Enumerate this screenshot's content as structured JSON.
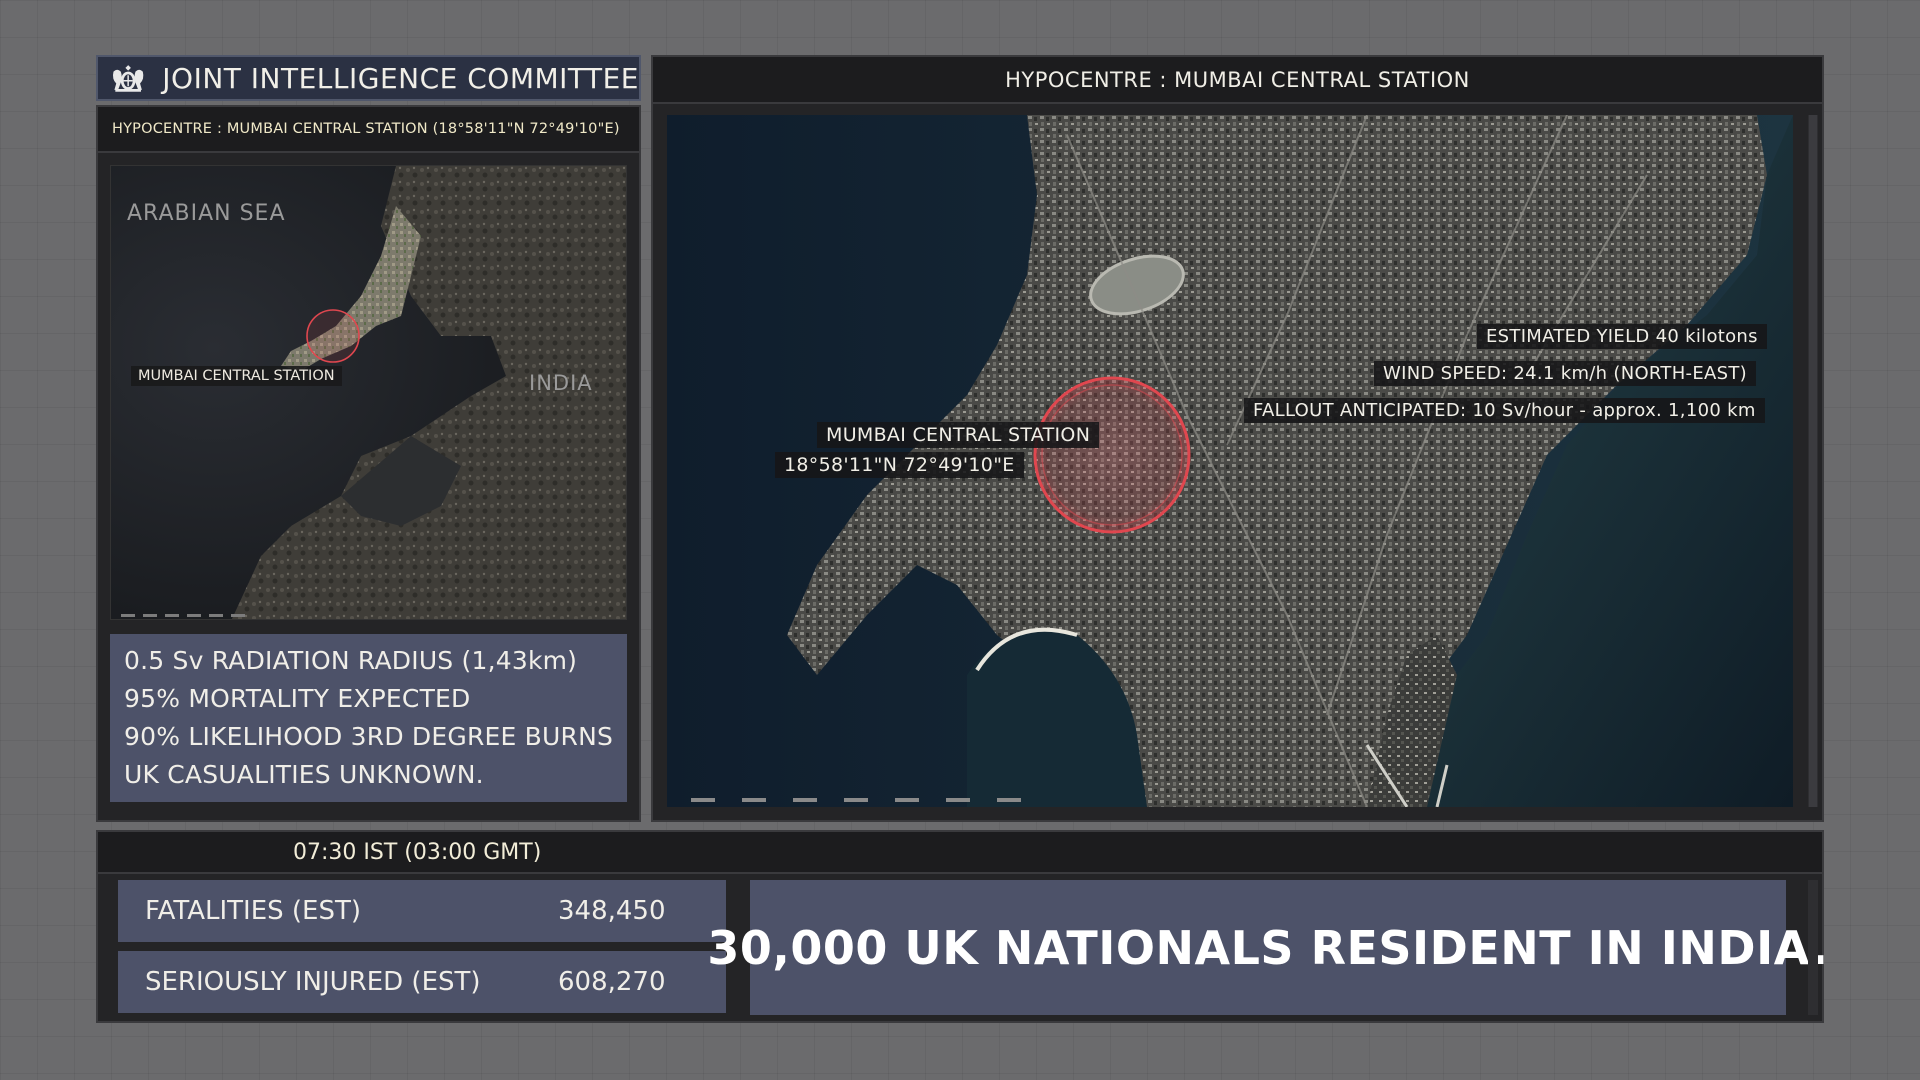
{
  "header": {
    "title": "JOINT INTELLIGENCE COMMITTEE",
    "crest_icon": "royal-crest-icon"
  },
  "left": {
    "caption": "HYPOCENTRE : MUMBAI CENTRAL STATION (18°58'11\"N 72°49'10\"E)",
    "map_labels": {
      "sea": "ARABIAN SEA",
      "country": "INDIA",
      "station": "MUMBAI CENTRAL STATION"
    },
    "stats": [
      "0.5 Sv RADIATION RADIUS (1,43km)",
      "95% MORTALITY EXPECTED",
      "90% LIKELIHOOD 3RD DEGREE BURNS",
      "UK CASUALITIES UNKNOWN."
    ]
  },
  "right": {
    "caption": "HYPOCENTRE : MUMBAI CENTRAL STATION",
    "station_label": "MUMBAI CENTRAL STATION",
    "coords": "18°58'11\"N 72°49'10\"E",
    "yield": "ESTIMATED YIELD 40 kilotons",
    "wind": "WIND SPEED: 24.1 km/h (NORTH-EAST)",
    "fallout": "FALLOUT ANTICIPATED: 10 Sv/hour - approx. 1,100 km"
  },
  "bottom": {
    "time": "07:30 IST (03:00 GMT)",
    "fatalities_label": "FATALITIES (EST)",
    "fatalities_value": "348,450",
    "injured_label": "SERIOUSLY INJURED (EST)",
    "injured_value": "608,270",
    "nationals": "30,000 UK NATIONALS RESIDENT IN INDIA."
  },
  "colors": {
    "background": "#6b6b6d",
    "panel": "#242426",
    "caption_bar": "#1c1c1e",
    "stat_box": "#4d5269",
    "header": "#2b3143",
    "blast_red": "#e0474f",
    "caption_text": "#f0e9c8"
  }
}
